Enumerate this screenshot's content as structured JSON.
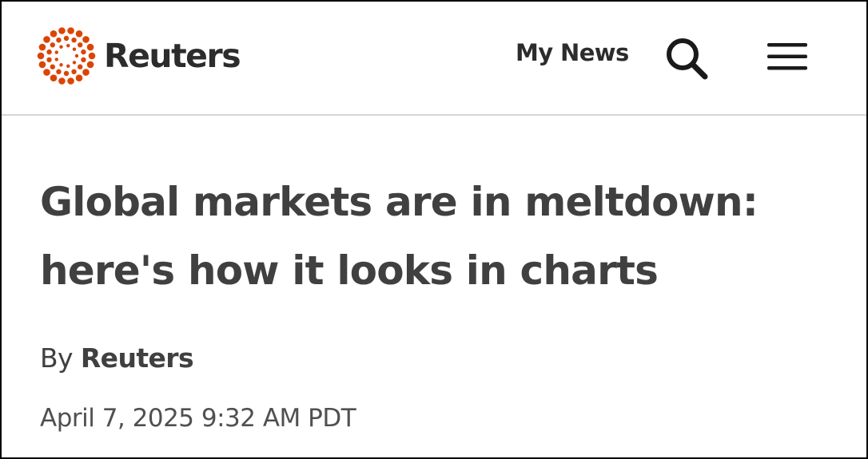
{
  "header": {
    "logo_text": "Reuters",
    "my_news_label": "My News",
    "search_icon": "search-icon",
    "menu_icon": "hamburger-menu-icon",
    "brand_color": "#DC4405"
  },
  "article": {
    "headline": "Global markets are in meltdown: here's how it looks in charts",
    "byline_prefix": "By",
    "author": "Reuters",
    "date": "April 7, 2025 9:32 AM PDT"
  }
}
